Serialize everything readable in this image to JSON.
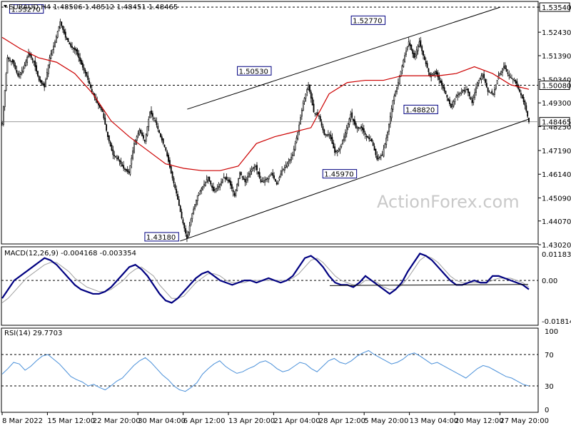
{
  "header": {
    "main": "EURAUD,H4 1.48506 1.48512 1.48451 1.48465",
    "macd": "MACD(12,26,9) -0.004168 -0.003354",
    "rsi": "RSI(14) 29.7703"
  },
  "watermark": "ActionForex.com",
  "colors": {
    "candle": "#000000",
    "ma": "#cc0000",
    "macd": "#000080",
    "signal": "#a0a0a0",
    "rsi": "#4a90d9",
    "grid": "#000000"
  },
  "chart_data": [
    {
      "type": "candlestick",
      "title": "EURAUD,H4",
      "ylim": [
        1.4302,
        1.5354
      ],
      "y_ticks": [
        "1.53540",
        "1.52430",
        "1.51390",
        "1.50340",
        "1.49300",
        "1.48250",
        "1.47190",
        "1.46140",
        "1.45090",
        "1.44070",
        "1.43020"
      ],
      "x_ticks": [
        "8 Mar 2022",
        "15 Mar 12:00",
        "22 Mar 20:00",
        "30 Mar 04:00",
        "6 Apr 12:00",
        "13 Apr 20:00",
        "21 Apr 04:00",
        "28 Apr 12:00",
        "5 May 20:00",
        "13 May 04:00",
        "20 May 12:00",
        "27 May 20:00"
      ],
      "close_path": [
        [
          0,
          1.484
        ],
        [
          4,
          1.513
        ],
        [
          8,
          1.511
        ],
        [
          12,
          1.505
        ],
        [
          16,
          1.508
        ],
        [
          20,
          1.515
        ],
        [
          24,
          1.511
        ],
        [
          28,
          1.503
        ],
        [
          32,
          1.5
        ],
        [
          36,
          1.513
        ],
        [
          40,
          1.52
        ],
        [
          44,
          1.529
        ],
        [
          48,
          1.522
        ],
        [
          52,
          1.518
        ],
        [
          56,
          1.516
        ],
        [
          60,
          1.51
        ],
        [
          64,
          1.505
        ],
        [
          68,
          1.498
        ],
        [
          72,
          1.493
        ],
        [
          76,
          1.489
        ],
        [
          80,
          1.478
        ],
        [
          84,
          1.47
        ],
        [
          88,
          1.468
        ],
        [
          92,
          1.464
        ],
        [
          96,
          1.462
        ],
        [
          100,
          1.475
        ],
        [
          104,
          1.481
        ],
        [
          108,
          1.476
        ],
        [
          112,
          1.489
        ],
        [
          116,
          1.485
        ],
        [
          120,
          1.478
        ],
        [
          124,
          1.472
        ],
        [
          128,
          1.462
        ],
        [
          132,
          1.453
        ],
        [
          136,
          1.442
        ],
        [
          140,
          1.433
        ],
        [
          144,
          1.444
        ],
        [
          148,
          1.452
        ],
        [
          152,
          1.456
        ],
        [
          156,
          1.46
        ],
        [
          160,
          1.454
        ],
        [
          164,
          1.456
        ],
        [
          168,
          1.46
        ],
        [
          172,
          1.458
        ],
        [
          176,
          1.452
        ],
        [
          180,
          1.462
        ],
        [
          184,
          1.458
        ],
        [
          188,
          1.463
        ],
        [
          192,
          1.465
        ],
        [
          196,
          1.458
        ],
        [
          200,
          1.459
        ],
        [
          204,
          1.462
        ],
        [
          208,
          1.457
        ],
        [
          212,
          1.463
        ],
        [
          216,
          1.466
        ],
        [
          220,
          1.47
        ],
        [
          224,
          1.48
        ],
        [
          228,
          1.493
        ],
        [
          232,
          1.501
        ],
        [
          236,
          1.489
        ],
        [
          240,
          1.487
        ],
        [
          244,
          1.479
        ],
        [
          248,
          1.479
        ],
        [
          252,
          1.471
        ],
        [
          256,
          1.473
        ],
        [
          260,
          1.48
        ],
        [
          264,
          1.488
        ],
        [
          268,
          1.482
        ],
        [
          272,
          1.482
        ],
        [
          276,
          1.478
        ],
        [
          280,
          1.476
        ],
        [
          284,
          1.468
        ],
        [
          288,
          1.47
        ],
        [
          292,
          1.48
        ],
        [
          296,
          1.494
        ],
        [
          300,
          1.502
        ],
        [
          304,
          1.512
        ],
        [
          308,
          1.52
        ],
        [
          312,
          1.513
        ],
        [
          316,
          1.52
        ],
        [
          320,
          1.512
        ],
        [
          324,
          1.505
        ],
        [
          328,
          1.507
        ],
        [
          332,
          1.502
        ],
        [
          336,
          1.497
        ],
        [
          340,
          1.491
        ],
        [
          344,
          1.496
        ],
        [
          348,
          1.498
        ],
        [
          352,
          1.499
        ],
        [
          356,
          1.493
        ],
        [
          360,
          1.502
        ],
        [
          364,
          1.506
        ],
        [
          368,
          1.498
        ],
        [
          372,
          1.497
        ],
        [
          376,
          1.505
        ],
        [
          380,
          1.509
        ],
        [
          384,
          1.505
        ],
        [
          388,
          1.503
        ],
        [
          392,
          1.498
        ],
        [
          396,
          1.492
        ],
        [
          399,
          1.4846
        ]
      ],
      "ma_path": [
        [
          0,
          1.522
        ],
        [
          20,
          1.517
        ],
        [
          40,
          1.513
        ],
        [
          60,
          1.511
        ],
        [
          80,
          1.506
        ],
        [
          100,
          1.497
        ],
        [
          120,
          1.485
        ],
        [
          140,
          1.478
        ],
        [
          160,
          1.472
        ],
        [
          180,
          1.466
        ],
        [
          200,
          1.464
        ],
        [
          220,
          1.463
        ],
        [
          240,
          1.463
        ],
        [
          260,
          1.465
        ],
        [
          280,
          1.475
        ],
        [
          300,
          1.478
        ],
        [
          320,
          1.48
        ],
        [
          340,
          1.482
        ],
        [
          360,
          1.497
        ],
        [
          380,
          1.502
        ],
        [
          400,
          1.503
        ],
        [
          420,
          1.503
        ],
        [
          440,
          1.505
        ],
        [
          460,
          1.505
        ],
        [
          480,
          1.505
        ],
        [
          500,
          1.506
        ],
        [
          520,
          1.509
        ],
        [
          540,
          1.506
        ],
        [
          560,
          1.501
        ],
        [
          580,
          1.499
        ]
      ],
      "annotations": [
        {
          "label": "1.53270",
          "x": 30,
          "y": 1.5327
        },
        {
          "label": "1.50530",
          "x": 190,
          "y": 1.5053
        },
        {
          "label": "1.43180",
          "x": 125,
          "y": 1.4318
        },
        {
          "label": "1.45970",
          "x": 250,
          "y": 1.4597
        },
        {
          "label": "1.52770",
          "x": 270,
          "y": 1.5277
        },
        {
          "label": "1.48820",
          "x": 307,
          "y": 1.4882
        }
      ],
      "price_tags": [
        {
          "label": "1.53540",
          "y": 1.5354
        },
        {
          "label": "1.50080",
          "y": 1.5008
        },
        {
          "label": "1.48465",
          "y": 1.48465
        }
      ],
      "channel": {
        "upper": [
          [
            130,
            1.4902
          ],
          [
            350,
            1.5354
          ]
        ],
        "lower": [
          [
            125,
            1.4318
          ],
          [
            370,
            1.4858
          ]
        ]
      },
      "hlines": [
        1.5354,
        1.5008,
        1.48465
      ]
    },
    {
      "type": "line",
      "title": "MACD(12,26,9)",
      "ylim": [
        -0.018148,
        0.011839
      ],
      "y_ticks": [
        "0.011839",
        "0.00",
        "-0.018148"
      ],
      "series": [
        {
          "name": "MACD",
          "values": [
            -0.008,
            -0.004,
            0.0,
            0.002,
            0.004,
            0.006,
            0.008,
            0.01,
            0.009,
            0.007,
            0.004,
            0.001,
            -0.002,
            -0.004,
            -0.005,
            -0.006,
            -0.006,
            -0.005,
            -0.003,
            0.0,
            0.003,
            0.006,
            0.007,
            0.005,
            0.002,
            -0.002,
            -0.006,
            -0.009,
            -0.01,
            -0.008,
            -0.005,
            -0.002,
            0.001,
            0.003,
            0.004,
            0.002,
            0.0,
            -0.001,
            -0.002,
            -0.001,
            0.0,
            0.0,
            -0.001,
            0.0,
            0.001,
            0.0,
            -0.001,
            0.0,
            0.002,
            0.006,
            0.01,
            0.011,
            0.009,
            0.006,
            0.002,
            -0.001,
            -0.002,
            -0.002,
            -0.003,
            -0.001,
            0.002,
            0.0,
            -0.002,
            -0.004,
            -0.006,
            -0.004,
            -0.001,
            0.004,
            0.008,
            0.012,
            0.011,
            0.009,
            0.006,
            0.003,
            0.0,
            -0.002,
            -0.002,
            -0.001,
            0.0,
            -0.001,
            -0.001,
            0.002,
            0.002,
            0.001,
            0.0,
            -0.001,
            -0.002,
            -0.004
          ]
        },
        {
          "name": "Signal",
          "values": [
            -0.01,
            -0.008,
            -0.005,
            -0.002,
            0.001,
            0.003,
            0.005,
            0.007,
            0.008,
            0.008,
            0.006,
            0.004,
            0.001,
            -0.001,
            -0.003,
            -0.004,
            -0.005,
            -0.005,
            -0.004,
            -0.002,
            0.0,
            0.003,
            0.005,
            0.006,
            0.004,
            0.002,
            -0.002,
            -0.005,
            -0.008,
            -0.008,
            -0.007,
            -0.004,
            -0.001,
            0.001,
            0.003,
            0.003,
            0.002,
            0.0,
            -0.001,
            -0.001,
            -0.001,
            0.0,
            0.0,
            0.0,
            0.0,
            0.0,
            0.0,
            0.0,
            0.001,
            0.003,
            0.006,
            0.009,
            0.01,
            0.008,
            0.005,
            0.002,
            0.0,
            -0.001,
            -0.002,
            -0.002,
            0.0,
            0.0,
            -0.001,
            -0.003,
            -0.004,
            -0.004,
            -0.002,
            0.001,
            0.005,
            0.009,
            0.011,
            0.01,
            0.008,
            0.005,
            0.002,
            0.0,
            -0.001,
            -0.001,
            -0.001,
            -0.001,
            -0.001,
            0.0,
            0.001,
            0.001,
            0.001,
            0.0,
            -0.001,
            -0.003
          ]
        }
      ]
    },
    {
      "type": "line",
      "title": "RSI(14)",
      "ylim": [
        0,
        100
      ],
      "y_ticks": [
        "100",
        "70",
        "30",
        "0"
      ],
      "hlines": [
        70,
        30
      ],
      "series": [
        {
          "name": "RSI",
          "values": [
            45,
            52,
            60,
            58,
            50,
            55,
            62,
            68,
            70,
            64,
            58,
            50,
            42,
            38,
            35,
            30,
            32,
            28,
            25,
            30,
            36,
            40,
            48,
            56,
            62,
            66,
            60,
            52,
            44,
            38,
            30,
            25,
            23,
            28,
            34,
            45,
            52,
            58,
            62,
            55,
            50,
            46,
            48,
            52,
            55,
            60,
            62,
            58,
            52,
            48,
            50,
            55,
            60,
            58,
            52,
            48,
            55,
            62,
            65,
            60,
            58,
            62,
            68,
            72,
            75,
            70,
            66,
            62,
            58,
            60,
            64,
            70,
            72,
            68,
            63,
            58,
            60,
            56,
            52,
            48,
            44,
            40,
            46,
            52,
            56,
            54,
            50,
            46,
            42,
            40,
            36,
            32,
            30
          ]
        }
      ]
    }
  ]
}
